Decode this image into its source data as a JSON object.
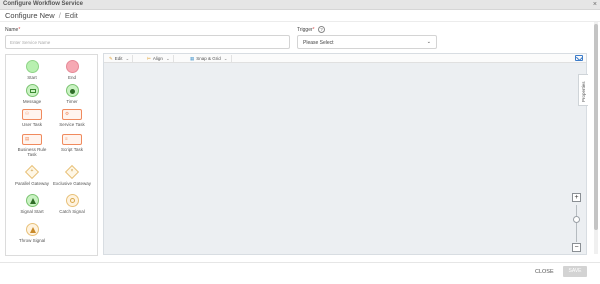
{
  "window": {
    "title": "Configure Workflow Service",
    "close_glyph": "×"
  },
  "breadcrumb": {
    "root": "Configure New",
    "separator": "/",
    "current": "Edit"
  },
  "form": {
    "name_label": "Name",
    "name_placeholder": "Enter Service Name",
    "name_value": "",
    "required_mark": "*",
    "trigger_label": "Trigger",
    "trigger_help": "?",
    "trigger_value": "Please Select",
    "chevron": "⌄"
  },
  "palette": {
    "start": "Start",
    "end": "End",
    "message": "Message",
    "timer": "Timer",
    "user_task": "User Task",
    "service_task": "Service Task",
    "business_rule_task": "Business Rule Task",
    "script_task": "Script Task",
    "parallel_gateway": "Parallel Gateway",
    "exclusive_gateway": "Exclusive Gateway",
    "signal_start": "Signal Start",
    "catch_signal": "Catch Signal",
    "throw_signal": "Throw Signal"
  },
  "toolbar": {
    "edit": "Edit",
    "align": "Align",
    "snap_grid": "Snap & Grid",
    "dropdown_glyph": "⌄"
  },
  "canvas": {
    "properties_tab": "Properties",
    "zoom_in": "+",
    "zoom_out": "−",
    "zoom_level": 0.7
  },
  "footer": {
    "close": "CLOSE",
    "save": "SAVE"
  },
  "colors": {
    "start": "#b8f0b0",
    "end": "#f6a9b3",
    "task_border": "#f08a5d",
    "gateway_border": "#e8c17a",
    "canvas_bg": "#eceff2"
  }
}
